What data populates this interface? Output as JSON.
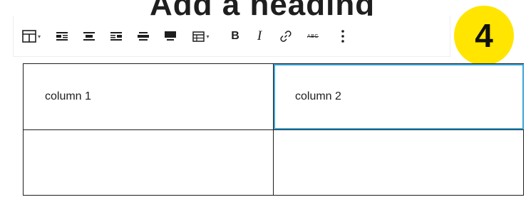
{
  "background_title": "Add a heading",
  "toolbar": {
    "items": [
      {
        "name": "table-icon",
        "has_dropdown": true
      },
      {
        "name": "align-left-icon"
      },
      {
        "name": "align-center-icon"
      },
      {
        "name": "align-right-icon"
      },
      {
        "name": "wide-width-icon"
      },
      {
        "name": "full-width-icon"
      },
      {
        "name": "edit-table-icon",
        "has_dropdown": true
      },
      {
        "name": "bold-icon",
        "label": "B"
      },
      {
        "name": "italic-icon",
        "label": "I"
      },
      {
        "name": "link-icon"
      },
      {
        "name": "strikethrough-icon",
        "label": "ABC"
      },
      {
        "name": "more-options-icon"
      }
    ]
  },
  "badge": {
    "number": "4",
    "color": "#ffe500"
  },
  "table": {
    "rows": [
      [
        "column 1",
        "column 2"
      ],
      [
        "",
        ""
      ]
    ],
    "selected_cell": [
      0,
      1
    ],
    "selection_color": "#3aa5d8"
  }
}
